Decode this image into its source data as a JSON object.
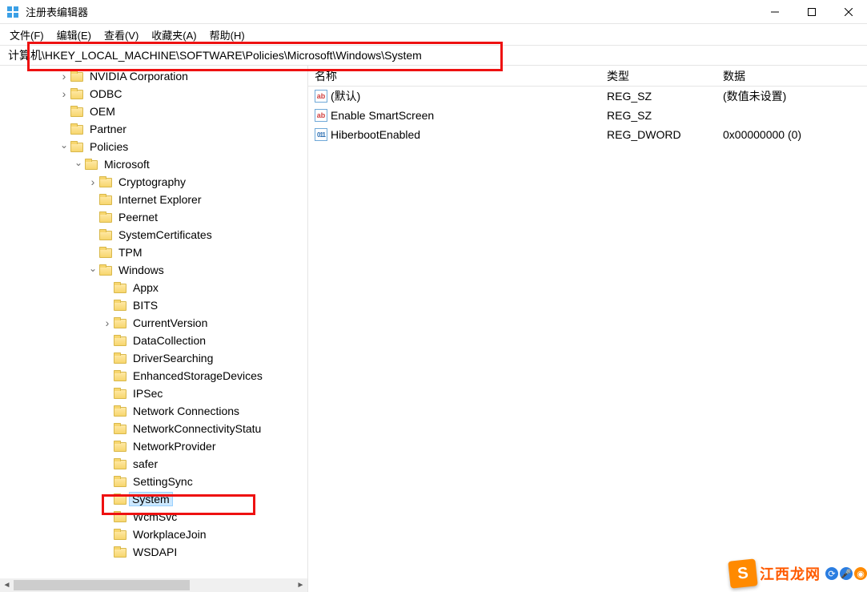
{
  "window": {
    "title": "注册表编辑器"
  },
  "menus": {
    "file": "文件(F)",
    "edit": "编辑(E)",
    "view": "查看(V)",
    "favorites": "收藏夹(A)",
    "help": "帮助(H)"
  },
  "address": {
    "path": "计算机\\HKEY_LOCAL_MACHINE\\SOFTWARE\\Policies\\Microsoft\\Windows\\System"
  },
  "tree": {
    "items": [
      {
        "indent": 4,
        "expand": ">",
        "label": "NVIDIA Corporation"
      },
      {
        "indent": 4,
        "expand": ">",
        "label": "ODBC"
      },
      {
        "indent": 4,
        "expand": "",
        "label": "OEM"
      },
      {
        "indent": 4,
        "expand": "",
        "label": "Partner"
      },
      {
        "indent": 4,
        "expand": "v",
        "label": "Policies"
      },
      {
        "indent": 5,
        "expand": "v",
        "label": "Microsoft"
      },
      {
        "indent": 6,
        "expand": ">",
        "label": "Cryptography"
      },
      {
        "indent": 6,
        "expand": "",
        "label": "Internet Explorer"
      },
      {
        "indent": 6,
        "expand": "",
        "label": "Peernet"
      },
      {
        "indent": 6,
        "expand": "",
        "label": "SystemCertificates"
      },
      {
        "indent": 6,
        "expand": "",
        "label": "TPM"
      },
      {
        "indent": 6,
        "expand": "v",
        "label": "Windows"
      },
      {
        "indent": 7,
        "expand": "",
        "label": "Appx"
      },
      {
        "indent": 7,
        "expand": "",
        "label": "BITS"
      },
      {
        "indent": 7,
        "expand": ">",
        "label": "CurrentVersion"
      },
      {
        "indent": 7,
        "expand": "",
        "label": "DataCollection"
      },
      {
        "indent": 7,
        "expand": "",
        "label": "DriverSearching"
      },
      {
        "indent": 7,
        "expand": "",
        "label": "EnhancedStorageDevices"
      },
      {
        "indent": 7,
        "expand": "",
        "label": "IPSec"
      },
      {
        "indent": 7,
        "expand": "",
        "label": "Network Connections"
      },
      {
        "indent": 7,
        "expand": "",
        "label": "NetworkConnectivityStatu"
      },
      {
        "indent": 7,
        "expand": "",
        "label": "NetworkProvider"
      },
      {
        "indent": 7,
        "expand": "",
        "label": "safer"
      },
      {
        "indent": 7,
        "expand": "",
        "label": "SettingSync"
      },
      {
        "indent": 7,
        "expand": "",
        "label": "System",
        "selected": true
      },
      {
        "indent": 7,
        "expand": "",
        "label": "WcmSvc"
      },
      {
        "indent": 7,
        "expand": "",
        "label": "WorkplaceJoin"
      },
      {
        "indent": 7,
        "expand": "",
        "label": "WSDAPI"
      }
    ]
  },
  "list": {
    "headers": {
      "name": "名称",
      "type": "类型",
      "data": "数据"
    },
    "rows": [
      {
        "icon": "ab",
        "name": "(默认)",
        "type": "REG_SZ",
        "data": "(数值未设置)"
      },
      {
        "icon": "ab",
        "name": "Enable SmartScreen",
        "type": "REG_SZ",
        "data": ""
      },
      {
        "icon": "bin",
        "name": "HiberbootEnabled",
        "type": "REG_DWORD",
        "data": "0x00000000 (0)"
      }
    ]
  },
  "watermark": {
    "text": "江西龙网"
  }
}
